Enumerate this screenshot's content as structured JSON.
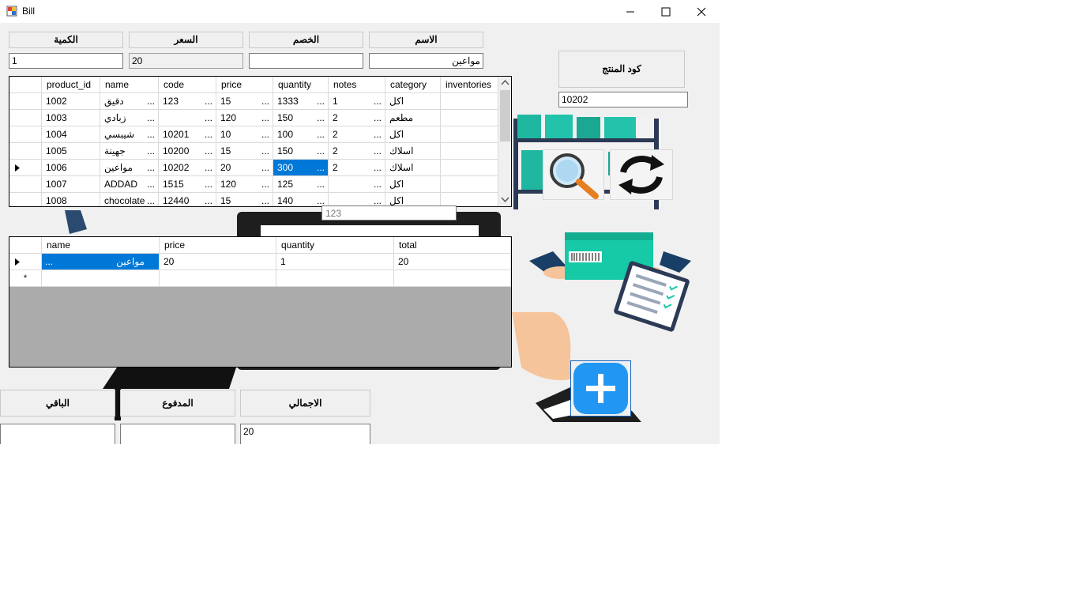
{
  "window": {
    "title": "Bill",
    "minimize_icon": "minimize-icon",
    "maximize_icon": "maximize-icon",
    "close_icon": "close-icon"
  },
  "top_labels": {
    "name": "الاسم",
    "discount": "الخصم",
    "price": "السعر",
    "quantity": "الكمية"
  },
  "top_values": {
    "name": "مواعين",
    "discount": "",
    "price": "20",
    "quantity": "1"
  },
  "product_code": {
    "label": "كود المنتج",
    "value": "10202"
  },
  "products_grid": {
    "columns": [
      "product_id",
      "name",
      "code",
      "price",
      "quantity",
      "notes",
      "category",
      "inventories"
    ],
    "rows": [
      [
        "1002",
        "دقيق",
        "123",
        "15",
        "1333",
        "1",
        "اكل",
        ""
      ],
      [
        "1003",
        "زبادي",
        "",
        "120",
        "150",
        "2",
        "مطعم",
        ""
      ],
      [
        "1004",
        "شيبسي",
        "10201",
        "10",
        "100",
        "2",
        "اكل",
        ""
      ],
      [
        "1005",
        "جهينة",
        "10200",
        "15",
        "150",
        "2",
        "اسلاك",
        ""
      ],
      [
        "1006",
        "مواعين",
        "10202",
        "20",
        "300",
        "2",
        "اسلاك",
        ""
      ],
      [
        "1007",
        "ADDAD",
        "1515",
        "120",
        "125",
        "",
        "اكل",
        ""
      ],
      [
        "1008",
        "chocolate",
        "12440",
        "15",
        "140",
        "",
        "اكل",
        ""
      ]
    ],
    "tooltip": "123"
  },
  "bill_grid": {
    "columns": [
      "name",
      "price",
      "quantity",
      "total"
    ],
    "rows": [
      [
        "مواعين",
        "20",
        "1",
        "20"
      ]
    ],
    "new_row_marker": "*"
  },
  "totals": {
    "total_label": "الاجمالي",
    "paid_label": "المدفوع",
    "remaining_label": "الباقي",
    "total_value": "20",
    "paid_value": "",
    "remaining_value": ""
  },
  "icons": {
    "search": "search-icon",
    "refresh": "refresh-icon",
    "add": "plus-icon"
  },
  "colors": {
    "selection": "#0078d7",
    "add_button": "#2196f3",
    "teal": "#14b8a0"
  }
}
